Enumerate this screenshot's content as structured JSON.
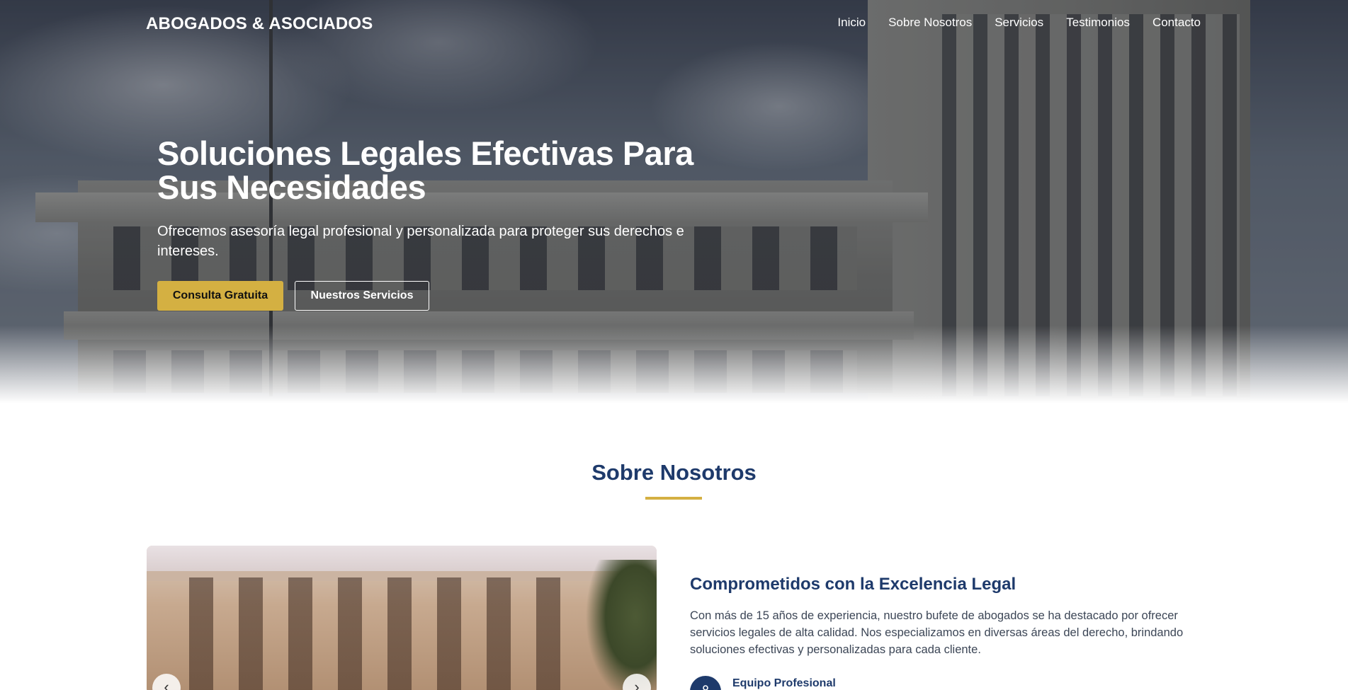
{
  "nav": {
    "logo": "ABOGADOS & ASOCIADOS",
    "links": [
      "Inicio",
      "Sobre Nosotros",
      "Servicios",
      "Testimonios",
      "Contacto"
    ]
  },
  "hero": {
    "title_line1": "Soluciones Legales Efectivas Para",
    "title_line2": "Sus Necesidades",
    "subtitle": "Ofrecemos asesoría legal profesional y personalizada para proteger sus derechos e intereses.",
    "primary_button": "Consulta Gratuita",
    "secondary_button": "Nuestros Servicios"
  },
  "about": {
    "section_title": "Sobre Nosotros",
    "heading": "Comprometidos con la Excelencia Legal",
    "paragraph": "Con más de 15 años de experiencia, nuestro bufete de abogados se ha destacado por ofrecer servicios legales de alta calidad. Nos especializamos en diversas áreas del derecho, brindando soluciones efectivas y personalizadas para cada cliente.",
    "features": [
      {
        "title": "Equipo Profesional",
        "icon": "users-icon"
      }
    ],
    "carousel": {
      "prev_icon": "chevron-left-icon",
      "next_icon": "chevron-right-icon"
    }
  },
  "colors": {
    "accent_gold": "#d4b042",
    "navy": "#1e3a6b"
  }
}
